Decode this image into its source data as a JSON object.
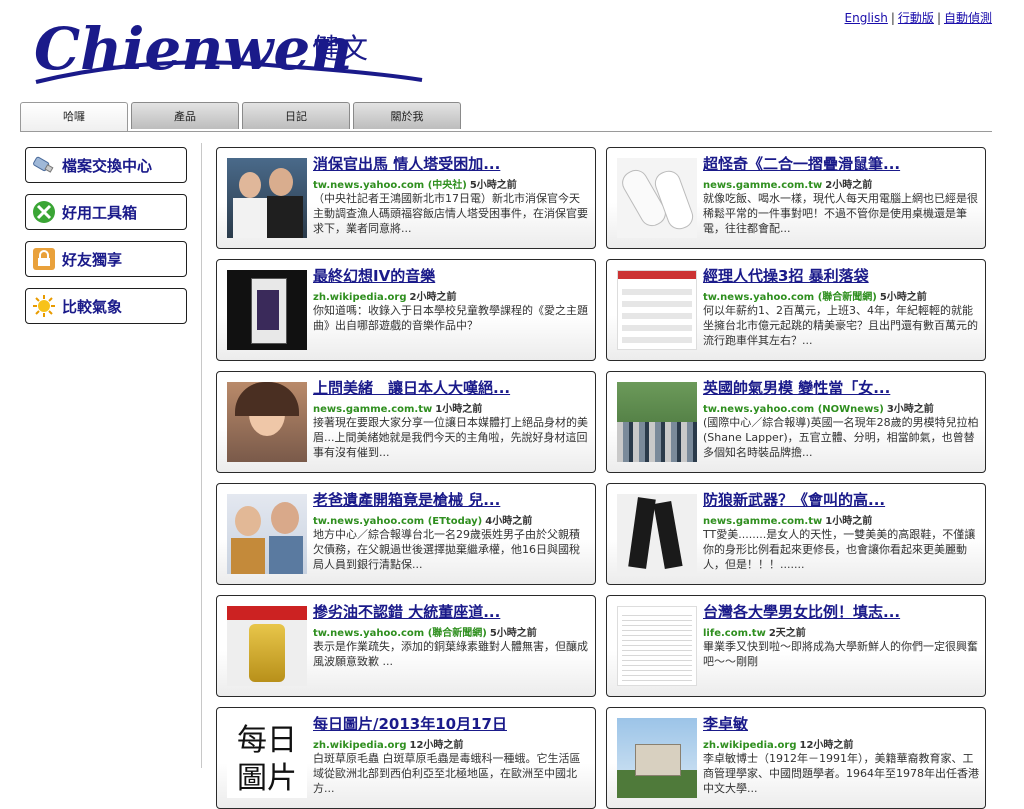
{
  "top_links": [
    {
      "label": "English"
    },
    {
      "label": "行動版"
    },
    {
      "label": "自動偵測"
    }
  ],
  "logo": {
    "text": "Chienwen",
    "cjk": "健文",
    "color": "#1a1a8a"
  },
  "tabs": [
    {
      "label": "哈囉",
      "active": true
    },
    {
      "label": "產品",
      "active": false
    },
    {
      "label": "日記",
      "active": false
    },
    {
      "label": "關於我",
      "active": false
    }
  ],
  "sidebar": [
    {
      "label": "檔案交換中心",
      "icon": "usb-drive-icon"
    },
    {
      "label": "好用工具箱",
      "icon": "tools-icon"
    },
    {
      "label": "好友獨享",
      "icon": "lock-icon"
    },
    {
      "label": "比較氣象",
      "icon": "sun-icon"
    }
  ],
  "cards": [
    {
      "title": "消保官出馬 情人塔受困加...",
      "source": "tw.news.yahoo.com (中央社)",
      "age": "5小時之前",
      "desc": "（中央社記者王鴻國新北市17日電）新北市消保官今天主動調查漁人碼頭福容飯店情人塔受困事件，在消保官要求下，業者同意將...",
      "thumb": "photo-people"
    },
    {
      "title": "超怪奇《二合一摺疊滑鼠筆...",
      "source": "news.gamme.com.tw",
      "age": "2小時之前",
      "desc": "就像吃飯、喝水一樣，現代人每天用電腦上網也已經是很稀鬆平常的一件事對吧！不過不管你是使用桌機還是筆電，往往都會配...",
      "thumb": "photo-mouse"
    },
    {
      "title": "最終幻想IV的音樂",
      "source": "zh.wikipedia.org",
      "age": "2小時之前",
      "desc": "你知道嗎：收錄入于日本學校兒童教學課程的《愛之主題曲》出自哪部遊戲的音樂作品中？",
      "thumb": "photo-album"
    },
    {
      "title": "經理人代操3招 暴利落袋",
      "source": "tw.news.yahoo.com (聯合新聞網)",
      "age": "5小時之前",
      "desc": "何以年薪約1、2百萬元，上班3、4年，年紀輕輕的就能坐擁台北市億元起跳的精美豪宅？且出門還有數百萬元的流行跑車伴其左右？...",
      "thumb": "photo-table"
    },
    {
      "title": "上問美緒　讓日本人大嘆絕...",
      "source": "news.gamme.com.tw",
      "age": "1小時之前",
      "desc": "接著現在要跟大家分享一位讓日本媒體打上絕品身材的美眉...上間美緒她就是我們今天的主角啦，先說好身材這回事有沒有催到...",
      "thumb": "photo-portrait"
    },
    {
      "title": "英國帥氣男模 變性當「女...",
      "source": "tw.news.yahoo.com (NOWnews)",
      "age": "3小時之前",
      "desc": "(國際中心／綜合報導)英國一名現年28歲的男模特兒拉柏(Shane Lapper)，五官立體、分明，相當帥氣，也曾替多個知名時裝品牌擔...",
      "thumb": "photo-crowd"
    },
    {
      "title": "老爸遺產開箱竟是槍械 兒...",
      "source": "tw.news.yahoo.com (ETtoday)",
      "age": "4小時之前",
      "desc": "地方中心／綜合報導台北一名29歲張姓男子由於父親積欠債務，在父親過世後選擇拋棄繼承權，他16日與國稅局人員到銀行清點保...",
      "thumb": "photo-couple"
    },
    {
      "title": "防狼新武器？《會叫的高...",
      "source": "news.gamme.com.tw",
      "age": "1小時之前",
      "desc": "TT愛美........是女人的天性，一雙美美的高跟鞋，不僅讓你的身形比例看起來更修長，也會讓你看起來更美麗動人，但是！！！.......",
      "thumb": "photo-heels"
    },
    {
      "title": "摻劣油不認錯 大統董座道...",
      "source": "tw.news.yahoo.com (聯合新聞網)",
      "age": "5小時之前",
      "desc": "表示是作業疏失，添加的銅葉綠素雖對人體無害，但釀成風波願意致歉 ...",
      "thumb": "photo-oil"
    },
    {
      "title": "台灣各大學男女比例！填志...",
      "source": "life.com.tw",
      "age": "2天之前",
      "desc": "畢業季又快到啦～即將成為大學新鮮人的你們一定很興奮吧～～剛剛",
      "thumb": "photo-sheet"
    },
    {
      "title": "每日圖片/2013年10月17日",
      "source": "zh.wikipedia.org",
      "age": "12小時之前",
      "desc": "白斑草原毛蟲 白斑草原毛蟲是毒蛾科一種蛾。它生活區域從歐洲北部到西伯利亞至北極地區，在歐洲至中國北方...",
      "thumb": "photo-calligraphy"
    },
    {
      "title": "李卓敏",
      "source": "zh.wikipedia.org",
      "age": "12小時之前",
      "desc": "李卓敏博士（1912年－1991年），美籍華裔教育家、工商管理學家、中國問題學者。1964年至1978年出任香港中文大學...",
      "thumb": "photo-building"
    }
  ]
}
